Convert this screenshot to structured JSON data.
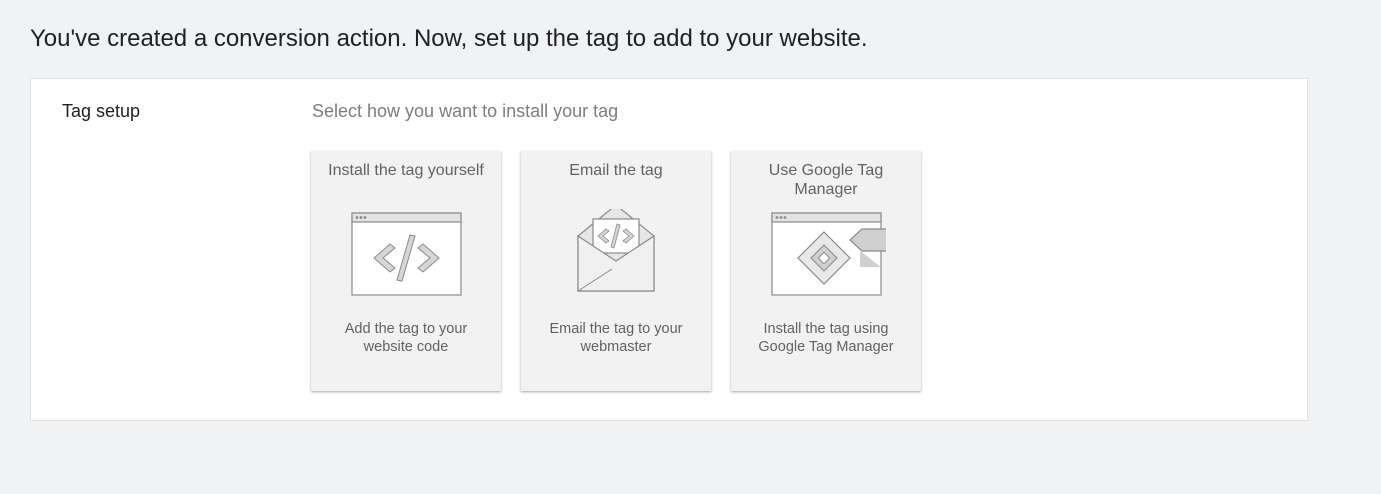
{
  "header": {
    "title": "You've created a conversion action. Now, set up the tag to add to your website."
  },
  "tag_setup": {
    "label": "Tag setup",
    "instruction": "Select how you want to install your tag",
    "options": [
      {
        "title": "Install the tag yourself",
        "description": "Add the tag to your website code",
        "icon": "browser-code-icon"
      },
      {
        "title": "Email the tag",
        "description": "Email the tag to your webmaster",
        "icon": "envelope-code-icon"
      },
      {
        "title": "Use Google Tag Manager",
        "description": "Install the tag using Google Tag Manager",
        "icon": "tag-manager-icon"
      }
    ]
  },
  "colors": {
    "background": "#f1f2f4",
    "card": "#f2f2f2",
    "icon_stroke": "#8a8a8a",
    "icon_fill": "#cfcfcf"
  }
}
